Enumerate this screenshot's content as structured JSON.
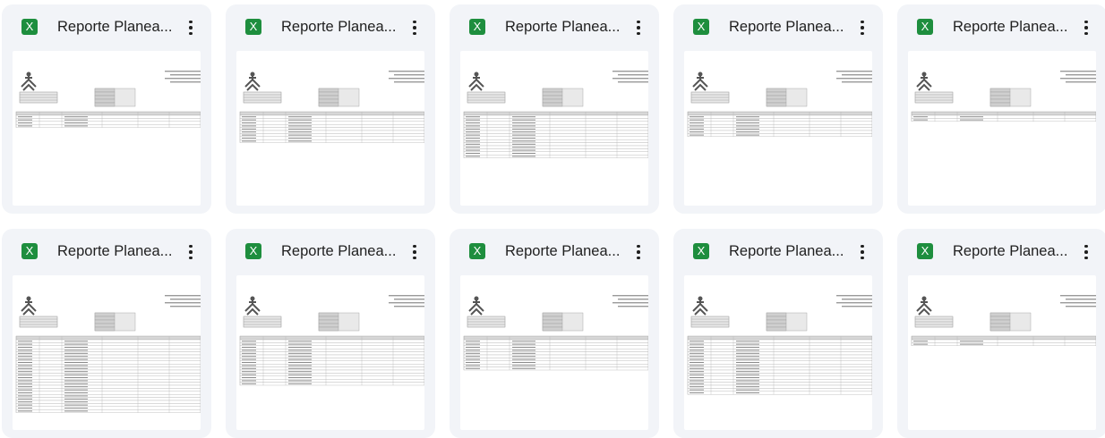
{
  "file_cards": [
    {
      "title": "Reporte Planea...",
      "type_icon": "X",
      "thumb_rows": 4
    },
    {
      "title": "Reporte Planea...",
      "type_icon": "X",
      "thumb_rows": 9
    },
    {
      "title": "Reporte Planea...",
      "type_icon": "X",
      "thumb_rows": 14
    },
    {
      "title": "Reporte Planea...",
      "type_icon": "X",
      "thumb_rows": 7
    },
    {
      "title": "Reporte Planea...",
      "type_icon": "X",
      "thumb_rows": 2
    },
    {
      "title": "Reporte Planea...",
      "type_icon": "X",
      "thumb_rows": 24
    },
    {
      "title": "Reporte Planea...",
      "type_icon": "X",
      "thumb_rows": 15
    },
    {
      "title": "Reporte Planea...",
      "type_icon": "X",
      "thumb_rows": 10
    },
    {
      "title": "Reporte Planea...",
      "type_icon": "X",
      "thumb_rows": 18
    },
    {
      "title": "Reporte Planea...",
      "type_icon": "X",
      "thumb_rows": 2
    }
  ],
  "colors": {
    "card_bg": "#f2f4f8",
    "excel_green": "#1e8e3e",
    "title_text": "#1f1f1f"
  },
  "icons": {
    "file_type": "excel-icon",
    "menu": "more-vert-icon"
  }
}
